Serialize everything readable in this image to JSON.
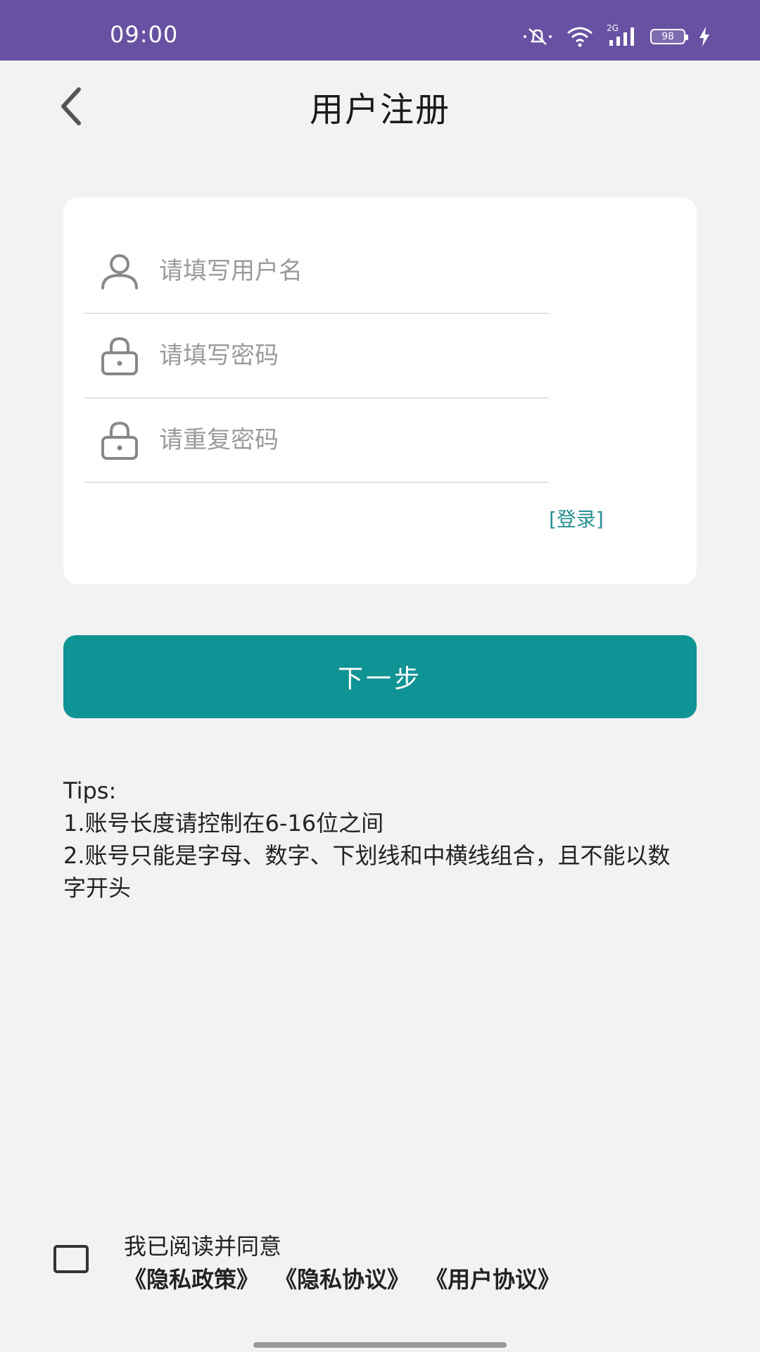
{
  "status_bar": {
    "time": "09:00",
    "network_label": "2G",
    "battery": "98",
    "icons": [
      "mute-icon",
      "wifi-icon",
      "signal-icon",
      "battery-icon",
      "charging-icon"
    ]
  },
  "header": {
    "title": "用户注册",
    "back_icon": "chevron-left-icon"
  },
  "form": {
    "username": {
      "placeholder": "请填写用户名",
      "value": "",
      "icon": "user-icon"
    },
    "password": {
      "placeholder": "请填写密码",
      "value": "",
      "icon": "lock-icon"
    },
    "repeat_password": {
      "placeholder": "请重复密码",
      "value": "",
      "icon": "lock-icon"
    },
    "login_link": "[登录]"
  },
  "next_button": "下一步",
  "tips": {
    "title": "Tips:",
    "line1": "1.账号长度请控制在6-16位之间",
    "line2": "2.账号只能是字母、数字、下划线和中横线组合，且不能以数字开头"
  },
  "agreement": {
    "checked": false,
    "text": "我已阅读并同意",
    "privacy_policy": "《隐私政策》",
    "privacy_agreement": "《隐私协议》",
    "user_agreement": "《用户协议》"
  },
  "colors": {
    "status_bar": "#6851a2",
    "primary": "#109394",
    "link": "#2a8f93",
    "background": "#f2f2f3"
  }
}
